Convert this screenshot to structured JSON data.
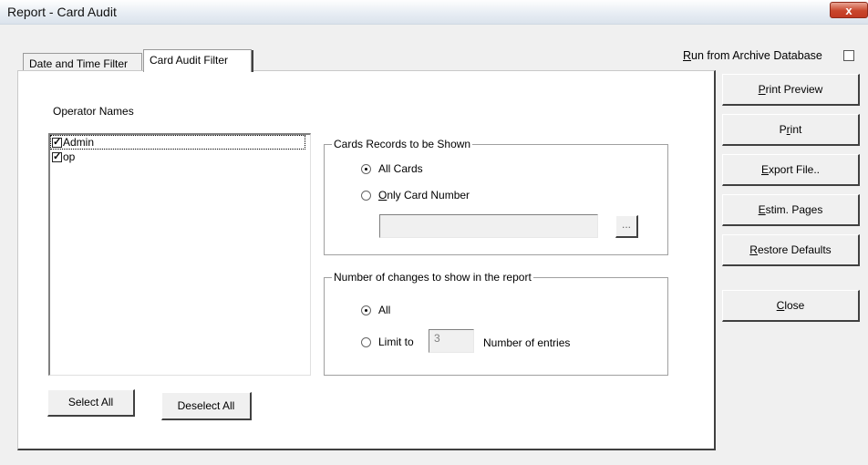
{
  "window": {
    "title": "Report  - Card Audit",
    "close_glyph": "x"
  },
  "tabs": [
    {
      "label": "Date and Time Filter",
      "active": false
    },
    {
      "label": "Card Audit Filter",
      "active": true
    }
  ],
  "archive": {
    "label_accel": "R",
    "label_rest": "un from Archive Database",
    "checked": false
  },
  "operators": {
    "heading": "Operator Names",
    "items": [
      {
        "name": "Admin",
        "checked": true
      },
      {
        "name": "op",
        "checked": true
      }
    ],
    "select_all": "Select All",
    "deselect_all": "Deselect All"
  },
  "cards_group": {
    "title": "Cards Records to be Shown",
    "option_all": "All Cards",
    "option_only_accel": "O",
    "option_only_rest": "nly Card Number",
    "selected": "All Cards",
    "card_number_value": "",
    "browse_label": "..."
  },
  "changes_group": {
    "title": "Number of changes to show in the report",
    "option_all": "All",
    "option_limit": "Limit to",
    "limit_value": "3",
    "entries_label": "Number of entries",
    "selected": "All"
  },
  "actions": {
    "print_preview_accel": "P",
    "print_preview_rest": "rint Preview",
    "print_pre": "P",
    "print_accel": "r",
    "print_rest": "int",
    "export_accel": "E",
    "export_rest": "xport File..",
    "estim_accel": "E",
    "estim_rest": "stim. Pages",
    "restore_accel": "R",
    "restore_rest": "estore Defaults",
    "close_accel": "C",
    "close_rest": "lose"
  },
  "colors": {
    "dialog_bg": "#f0f0f0",
    "panel_bg": "#ffffff",
    "close_button": "#c9462c"
  },
  "icons": {
    "close": "close-icon",
    "check": "check-icon"
  }
}
